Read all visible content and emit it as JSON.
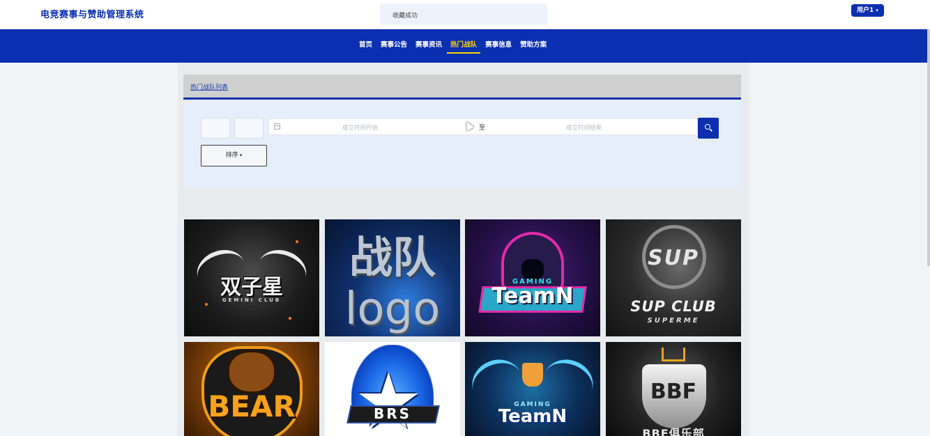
{
  "header": {
    "app_title": "电竞赛事与赞助管理系统",
    "toast": "收藏成功",
    "user_menu": "用户1"
  },
  "nav": {
    "items": [
      {
        "label": "首页"
      },
      {
        "label": "赛事公告"
      },
      {
        "label": "赛事资讯"
      },
      {
        "label": "热门战队",
        "active": true
      },
      {
        "label": "赛事信息"
      },
      {
        "label": "赞助方案"
      }
    ]
  },
  "list": {
    "breadcrumb": "热门战队列表"
  },
  "filters": {
    "date_start_placeholder": "成立时间开始",
    "date_separator": "至",
    "date_end_placeholder": "成立时间结束",
    "sort_label": "排序"
  },
  "cards": [
    {
      "logo_text": "双子星",
      "logo_sub": "GEMINI CLUB"
    },
    {
      "logo_text": "战队",
      "logo_sub": "logo"
    },
    {
      "logo_text": "TeamN",
      "logo_sub": "GAMING"
    },
    {
      "logo_text": "SUP CLUB",
      "logo_sub": "SUPERME",
      "logo_mark": "SUP"
    },
    {
      "logo_text": "BEAR"
    },
    {
      "logo_text": "BRS"
    },
    {
      "logo_text": "TeamN",
      "logo_sub": "GAMING"
    },
    {
      "logo_text": "BBF俱乐部",
      "logo_mark": "BBF"
    }
  ],
  "colors": {
    "primary": "#0a2fb0",
    "nav_active": "#ffd400",
    "page_bg": "#f1f4f6",
    "filter_bg": "#e6eefb"
  },
  "icons": {
    "search": "search-icon",
    "calendar": "calendar-icon",
    "dropdown": "caret-down-icon"
  }
}
